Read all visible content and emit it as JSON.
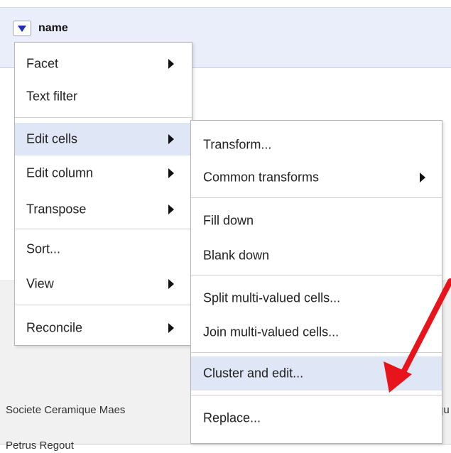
{
  "column": {
    "name": "name"
  },
  "rows": [
    {
      "text": "Societe Ceramique Maes"
    },
    {
      "text": "Petrus Regout"
    }
  ],
  "overflow_text": "qu",
  "column_menu": {
    "items": [
      {
        "label": "Facet",
        "has_submenu": true
      },
      {
        "label": "Text filter",
        "has_submenu": false
      },
      {
        "label": "Edit cells",
        "has_submenu": true,
        "active": true
      },
      {
        "label": "Edit column",
        "has_submenu": true
      },
      {
        "label": "Transpose",
        "has_submenu": true
      },
      {
        "label": "Sort...",
        "has_submenu": false
      },
      {
        "label": "View",
        "has_submenu": true
      },
      {
        "label": "Reconcile",
        "has_submenu": true
      }
    ]
  },
  "edit_cells_menu": {
    "items": [
      {
        "label": "Transform...",
        "has_submenu": false
      },
      {
        "label": "Common transforms",
        "has_submenu": true
      },
      {
        "label": "Fill down",
        "has_submenu": false
      },
      {
        "label": "Blank down",
        "has_submenu": false
      },
      {
        "label": "Split multi-valued cells...",
        "has_submenu": false
      },
      {
        "label": "Join multi-valued cells...",
        "has_submenu": false
      },
      {
        "label": "Cluster and edit...",
        "has_submenu": false,
        "highlighted": true
      },
      {
        "label": "Replace...",
        "has_submenu": false
      }
    ]
  },
  "colors": {
    "header_band": "#eaeefa",
    "menu_highlight": "#dfe6f5",
    "dropdown_triangle": "#1a2fb5",
    "annotation_arrow": "#e8141b"
  },
  "icons": {
    "column_dropdown": "triangle-down-icon",
    "submenu": "triangle-right-icon",
    "annotation": "red-arrow-icon"
  }
}
